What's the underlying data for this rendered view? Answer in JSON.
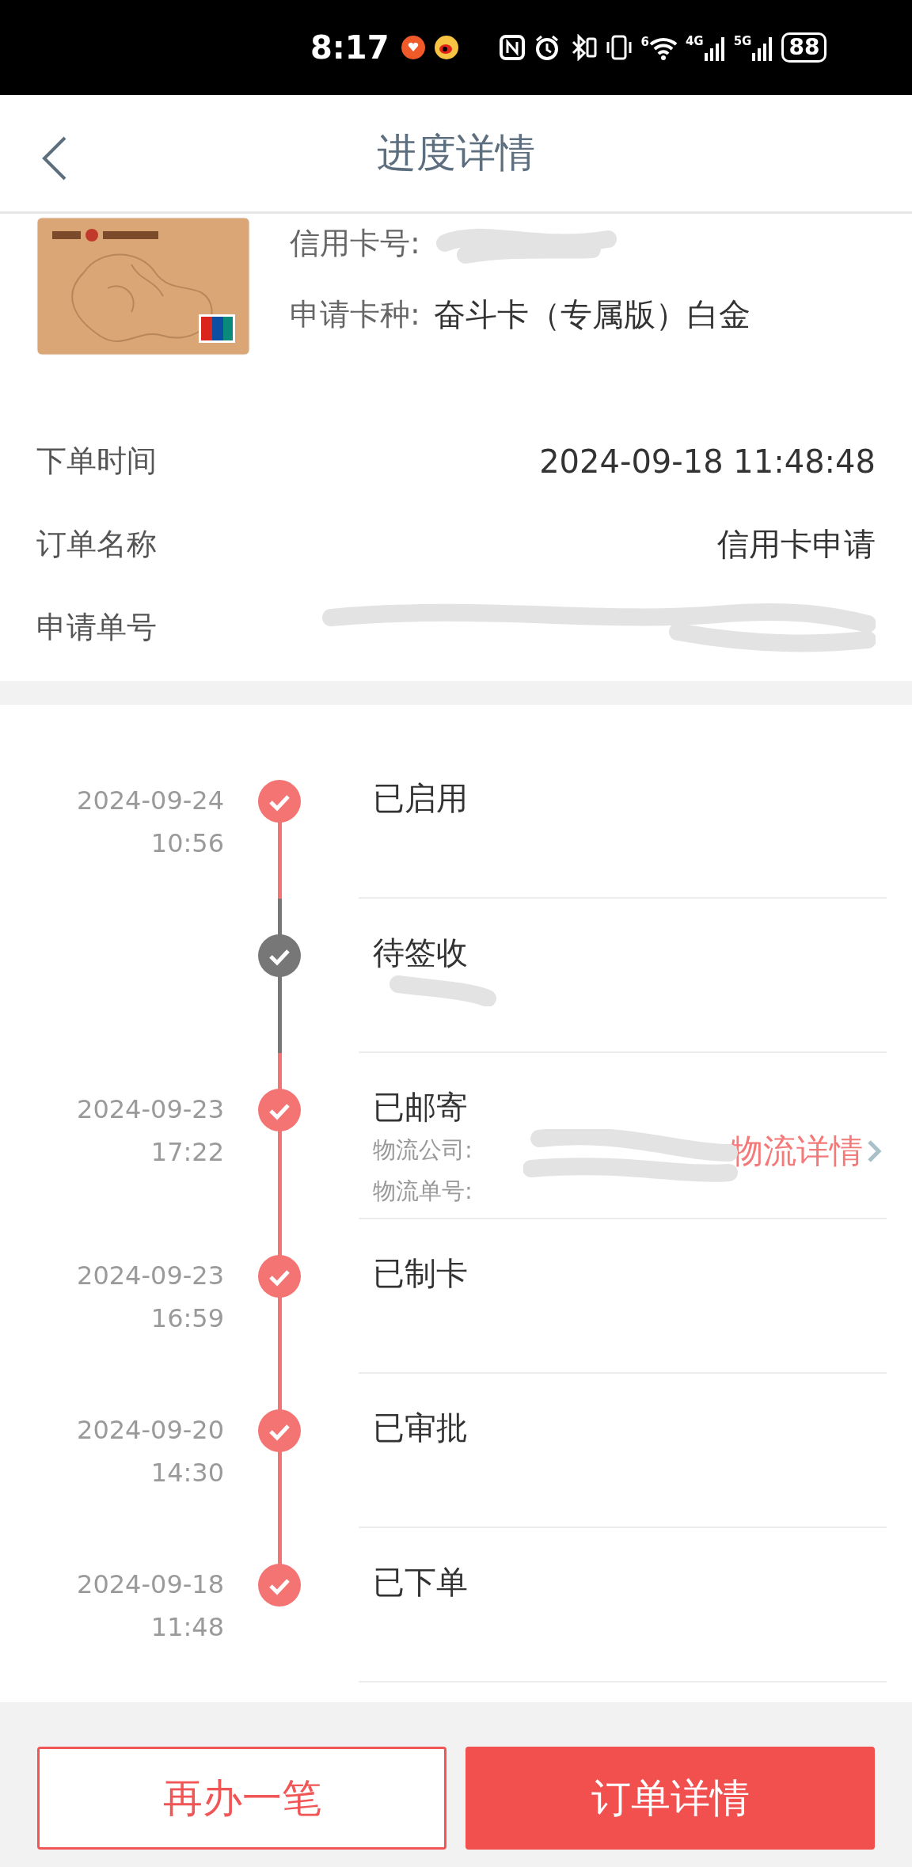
{
  "status_bar": {
    "time": "8:17",
    "wifi_label": "6",
    "network_1": "4G",
    "network_2": "5G",
    "battery": "88"
  },
  "header": {
    "title": "进度详情"
  },
  "card": {
    "number_label": "信用卡号:",
    "type_label": "申请卡种:",
    "type_value": "奋斗卡（专属版）白金"
  },
  "order_info": [
    {
      "label": "下单时间",
      "value": "2024-09-18 11:48:48"
    },
    {
      "label": "订单名称",
      "value": "信用卡申请"
    },
    {
      "label": "申请单号"
    }
  ],
  "timeline": [
    {
      "date": "2024-09-24",
      "time": "10:56",
      "status": "已启用",
      "completed": true
    },
    {
      "status": "待签收",
      "completed": false
    },
    {
      "date": "2024-09-23",
      "time": "17:22",
      "status": "已邮寄",
      "completed": true,
      "kind": "shipping",
      "company_label": "物流公司:",
      "tracking_label": "物流单号:",
      "link": "物流详情"
    },
    {
      "date": "2024-09-23",
      "time": "16:59",
      "status": "已制卡",
      "completed": true
    },
    {
      "date": "2024-09-20",
      "time": "14:30",
      "status": "已审批",
      "completed": true
    },
    {
      "date": "2024-09-18",
      "time": "11:48",
      "status": "已下单",
      "completed": true
    }
  ],
  "actions": [
    {
      "label": "再办一笔",
      "kind": "secondary"
    },
    {
      "label": "订单详情",
      "kind": "primary"
    }
  ]
}
